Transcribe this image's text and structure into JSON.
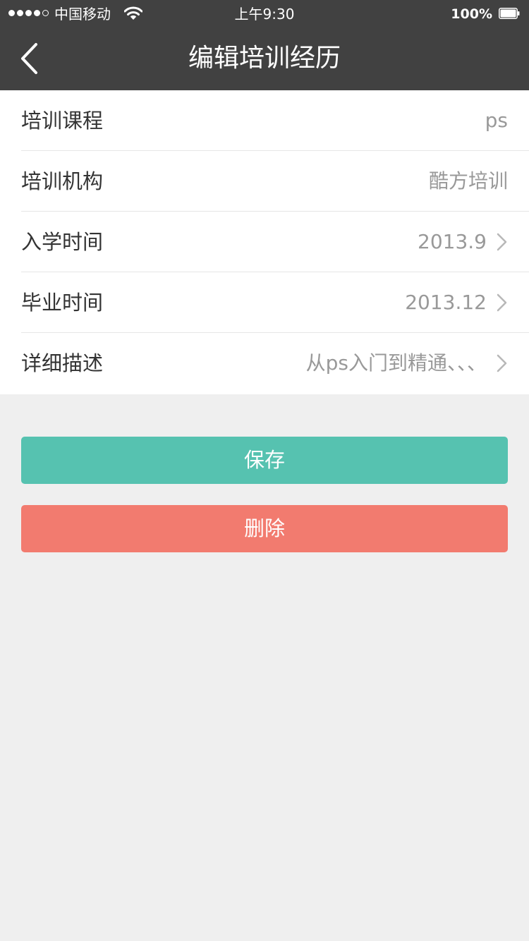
{
  "status_bar": {
    "carrier": "中国移动",
    "time": "上午9:30",
    "battery_percent": "100%",
    "signal_strength": 4,
    "signal_max": 5,
    "battery_level": 1.0
  },
  "nav": {
    "title": "编辑培训经历",
    "back_icon": "chevron-left-icon"
  },
  "form": {
    "rows": [
      {
        "label": "培训课程",
        "value": "ps",
        "has_arrow": false
      },
      {
        "label": "培训机构",
        "value": "酷方培训",
        "has_arrow": false
      },
      {
        "label": "入学时间",
        "value": "2013.9",
        "has_arrow": true
      },
      {
        "label": "毕业时间",
        "value": "2013.12",
        "has_arrow": true
      },
      {
        "label": "详细描述",
        "value": "从ps入门到精通、、、",
        "has_arrow": true
      }
    ]
  },
  "actions": {
    "save_label": "保存",
    "delete_label": "删除"
  },
  "colors": {
    "bar_background": "#414141",
    "page_background": "#efefef",
    "save_button": "#56c2b0",
    "delete_button": "#f27b6f",
    "value_text": "#999999",
    "label_text": "#333333"
  }
}
